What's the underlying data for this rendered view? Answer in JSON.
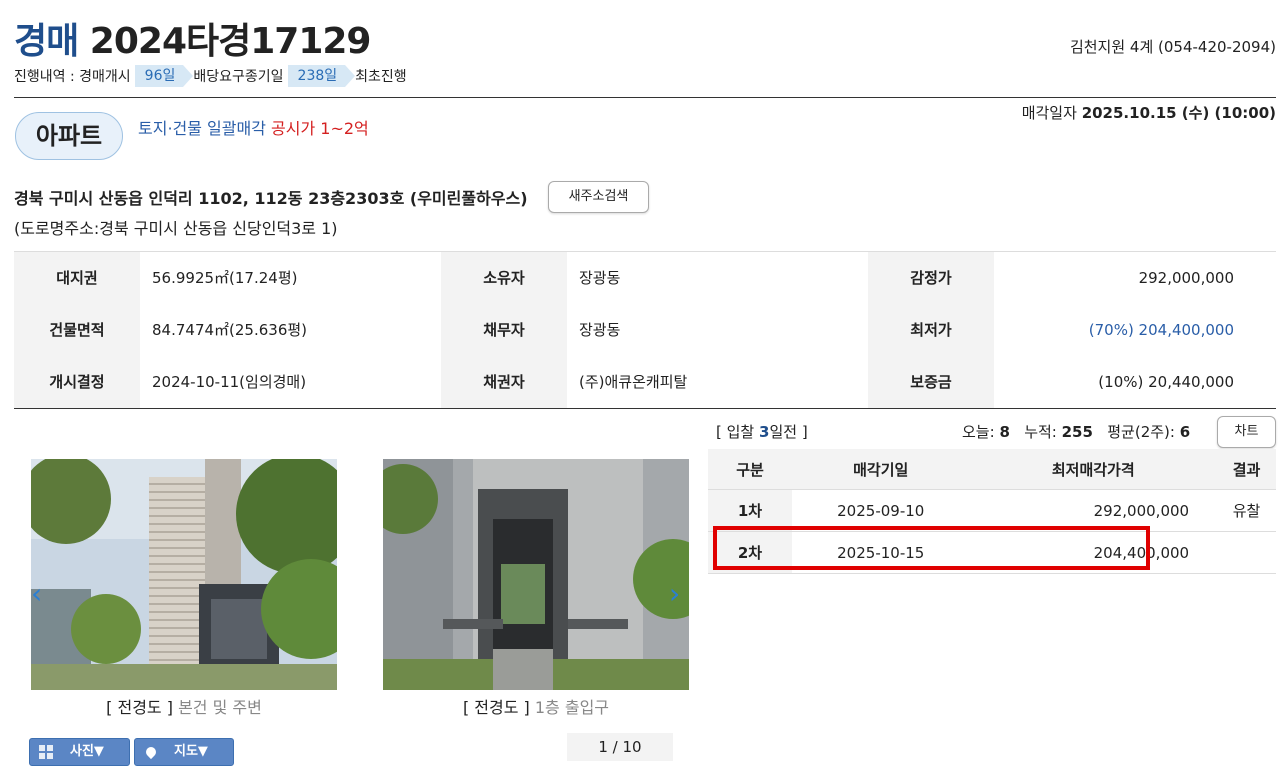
{
  "header": {
    "kind": "경매",
    "case_no": "2024타경17129",
    "court": "김천지원 4계 (054-420-2094)"
  },
  "progress": {
    "label": "진행내역 :",
    "steps": [
      {
        "name": "경매개시",
        "days": "96일"
      },
      {
        "name": "배당요구종기일",
        "days": "238일"
      },
      {
        "name": "최초진행",
        "days": ""
      }
    ]
  },
  "property": {
    "type_badge": "아파트",
    "sale_type": "토지·건물 일괄매각",
    "price_band": "공시가 1~2억",
    "sale_date_label": "매각일자",
    "sale_date_value": "2025.10.15 (수) (10:00)",
    "address": "경북 구미시 산동읍 인덕리 1102, 112동 23층2303호 (우미린풀하우스)",
    "new_address_button": "새주소검색",
    "road_address": "(도로명주소:경북 구미시 산동읍 신당인덕3로 1)"
  },
  "info": [
    {
      "l1": "대지권",
      "v1": "56.9925㎡(17.24평)",
      "l2": "소유자",
      "v2": "장광동",
      "l3": "감정가",
      "v3": "292,000,000"
    },
    {
      "l1": "건물면적",
      "v1": "84.7474㎡(25.636평)",
      "l2": "채무자",
      "v2": "장광동",
      "l3": "최저가",
      "v3": "(70%) 204,400,000"
    },
    {
      "l1": "개시결정",
      "v1": "2024-10-11(임의경매)",
      "l2": "채권자",
      "v2": "(주)애큐온캐피탈",
      "l3": "보증금",
      "v3": "(10%) 20,440,000"
    }
  ],
  "bid": {
    "prefix": "[ 입찰",
    "days": "3",
    "suffix": "일전 ]",
    "today_label": "오늘:",
    "today": "8",
    "total_label": "누적:",
    "total": "255",
    "avg_label": "평균(2주):",
    "avg": "6",
    "chart_button": "차트"
  },
  "rounds": {
    "headers": [
      "구분",
      "매각기일",
      "최저매각가격",
      "결과"
    ],
    "rows": [
      {
        "round": "1차",
        "date": "2025-09-10",
        "price": "292,000,000",
        "result": "유찰"
      },
      {
        "round": "2차",
        "date": "2025-10-15",
        "price": "204,400,000",
        "result": ""
      }
    ]
  },
  "photos": [
    {
      "tag": "[ 전경도 ]",
      "desc": "본건 및 주변"
    },
    {
      "tag": "[ 전경도 ]",
      "desc": "1층 출입구"
    }
  ],
  "controls": {
    "photo_button": "사진▼",
    "map_button": "지도▼",
    "pager": "1 / 10"
  },
  "colors": {
    "accent": "#1f4e8c",
    "highlight": "#e00000",
    "price_band": "#d42020"
  }
}
